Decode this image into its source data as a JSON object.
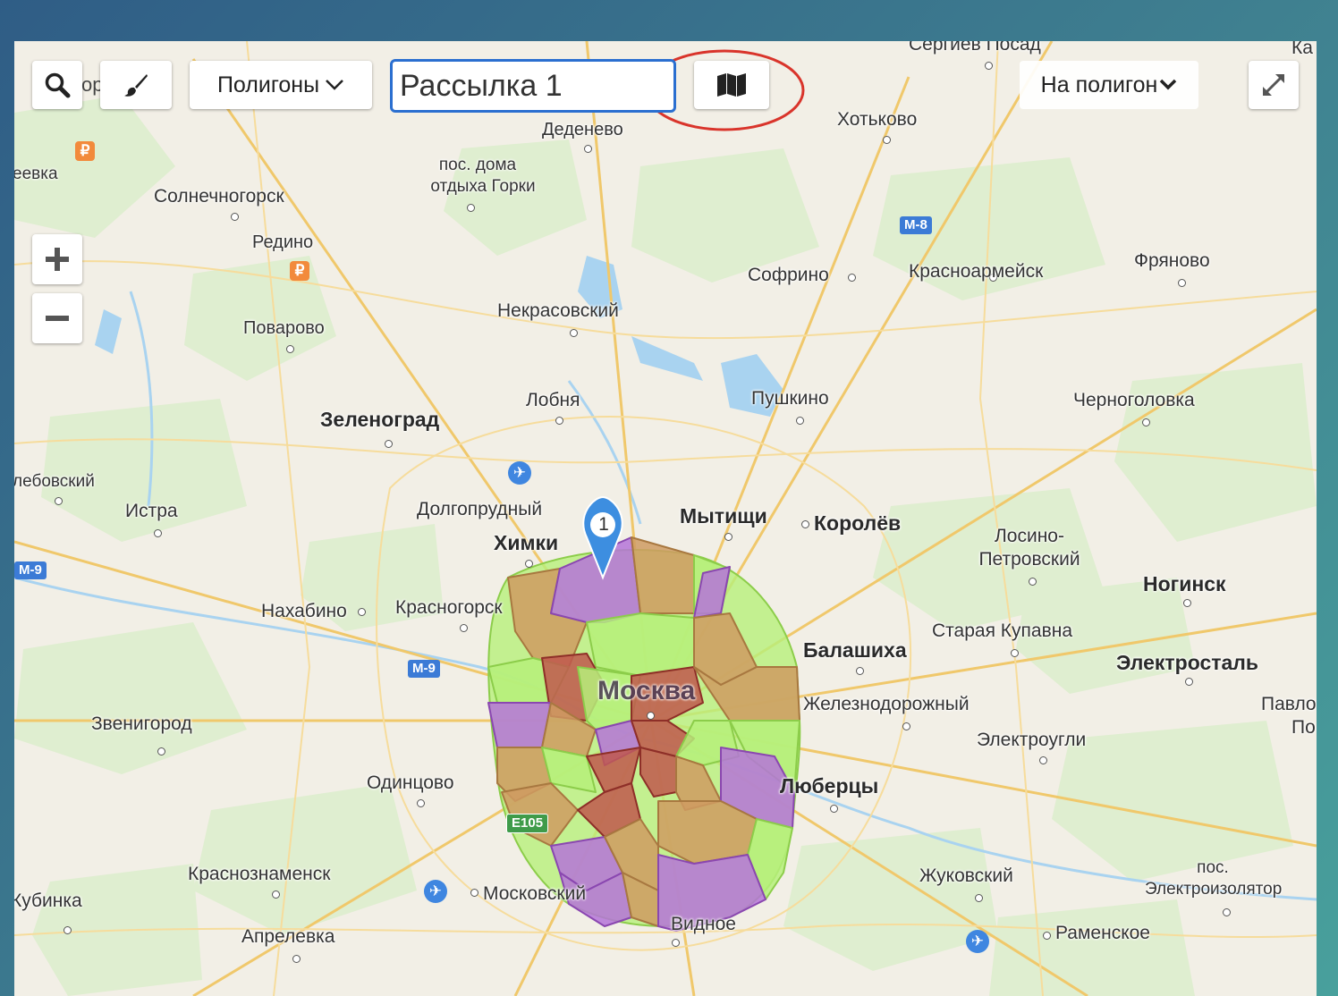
{
  "toolbar": {
    "search_partial_text": "ор",
    "polygons_dropdown_label": "Полигоны",
    "mailing_name_value": "Рассылка 1",
    "on_polygon_dropdown_label": "На полигон"
  },
  "marker": {
    "number": "1"
  },
  "colors": {
    "accent_input_border": "#2b6fd0",
    "highlight_circle": "#d9342b",
    "polygon_purple": "#b574d8",
    "polygon_brown": "#cf9b62",
    "polygon_green": "#b6f07a",
    "polygon_red": "#c0584e"
  },
  "icons": {
    "search": "search-icon",
    "brush": "brush-icon",
    "map": "map-icon",
    "fullscreen": "fullscreen-icon",
    "zoom_in": "plus-icon",
    "zoom_out": "minus-icon"
  },
  "roads": {
    "m8": "М-8",
    "m9_west": "М-9",
    "m9_east": "М-9",
    "e105": "E105"
  },
  "places": {
    "sergiev_posad": "Сергиев Посад",
    "ka": "Ка",
    "khotkovo": "Хотьково",
    "dedenevo": "Деденево",
    "gorki_line1": "пос. дома",
    "gorki_line2": "отдыха Горки",
    "eevka": "еевка",
    "solnechnogorsk": "Солнечногорск",
    "redino": "Редино",
    "sofrino": "Софрино",
    "krasnoarmeysk": "Красноармейск",
    "fryanovo": "Фряново",
    "nekrasovsky": "Некрасовский",
    "povarovo": "Поварово",
    "lobnya": "Лобня",
    "pushkino": "Пушкино",
    "chernogolovka": "Черноголовка",
    "zelenograd": "Зеленоград",
    "lebovsky": "лебовский",
    "istra": "Истра",
    "dolgoprudny": "Долгопрудный",
    "mytishchi": "Мытищи",
    "korolev": "Королёв",
    "khimki": "Химки",
    "losino_line1": "Лосино-",
    "losino_line2": "Петровский",
    "noginsk": "Ногинск",
    "nakhabino": "Нахабино",
    "krasnogorsk": "Красногорск",
    "staraya_kupavna": "Старая Купавна",
    "balashikha": "Балашиха",
    "elektrostal": "Электросталь",
    "moskva": "Москва",
    "zheleznodorozhny": "Железнодорожный",
    "pavlo_line1": "Павло",
    "pavlo_line2": "По",
    "zvenigorod": "Звенигород",
    "elektrougli": "Электроугли",
    "odintsovo": "Одинцово",
    "lyubertsy": "Люберцы",
    "krasnoznamensk": "Краснознаменск",
    "zhukovsky": "Жуковский",
    "elektroizolyator_line1": "пос.",
    "elektroizolyator_line2": "Электроизолятор",
    "kubinka": "Кубинка",
    "moskovsky": "Московский",
    "vidnoe": "Видное",
    "aprelevka": "Апрелевка",
    "ramenskoe": "Раменское"
  }
}
